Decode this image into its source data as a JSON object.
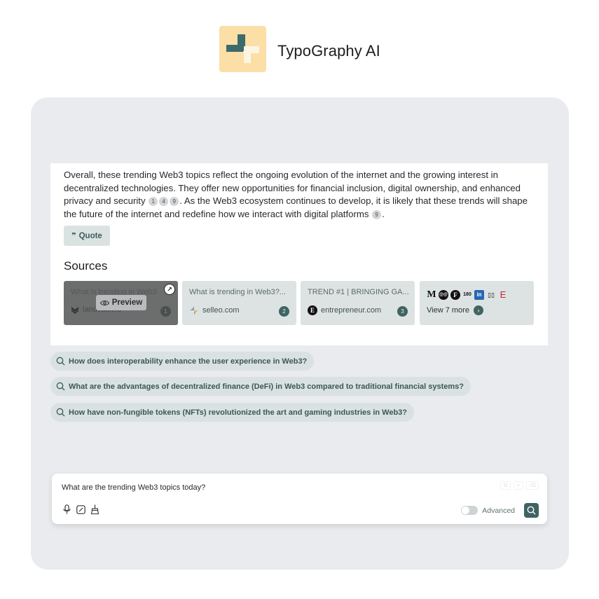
{
  "header": {
    "app_title": "TypoGraphy AI"
  },
  "answer": {
    "text_1": "Overall, these trending Web3 topics reflect the ongoing evolution of the internet and the growing interest in decentralized technologies. They offer new opportunities for financial inclusion, digital ownership, and enhanced privacy and security",
    "cites_1": [
      "1",
      "4",
      "9"
    ],
    "text_2": ". As the Web3 ecosystem continues to develop, it is likely that these trends will shape the future of the internet and redefine how we interact with digital platforms",
    "cites_2": [
      "9"
    ],
    "text_3": ".",
    "quote_label": "Quote",
    "sources_title": "Sources"
  },
  "sources": [
    {
      "title": "What is trending in Web3",
      "site": "landvault.io",
      "num": "1",
      "preview_label": "Preview"
    },
    {
      "title": "What is trending in Web3?...",
      "site": "selleo.com",
      "num": "2"
    },
    {
      "title": "TREND #1 | BRINGING GA...",
      "site": "entrepreneur.com",
      "num": "3"
    },
    {
      "view_more": "View 7 more"
    }
  ],
  "followups": [
    "How does interoperability enhance the user experience in Web3?",
    "What are the advantages of decentralized finance (DeFi) in Web3 compared to traditional financial systems?",
    "How have non-fungible tokens (NFTs) revolutionized the art and gaming industries in Web3?"
  ],
  "input": {
    "query": "What are the trending Web3 topics today?",
    "advanced_label": "Advanced"
  },
  "colors": {
    "accent": "#3f6462",
    "card_bg": "#e9ebee",
    "logo_bg": "#fbdfa6"
  }
}
